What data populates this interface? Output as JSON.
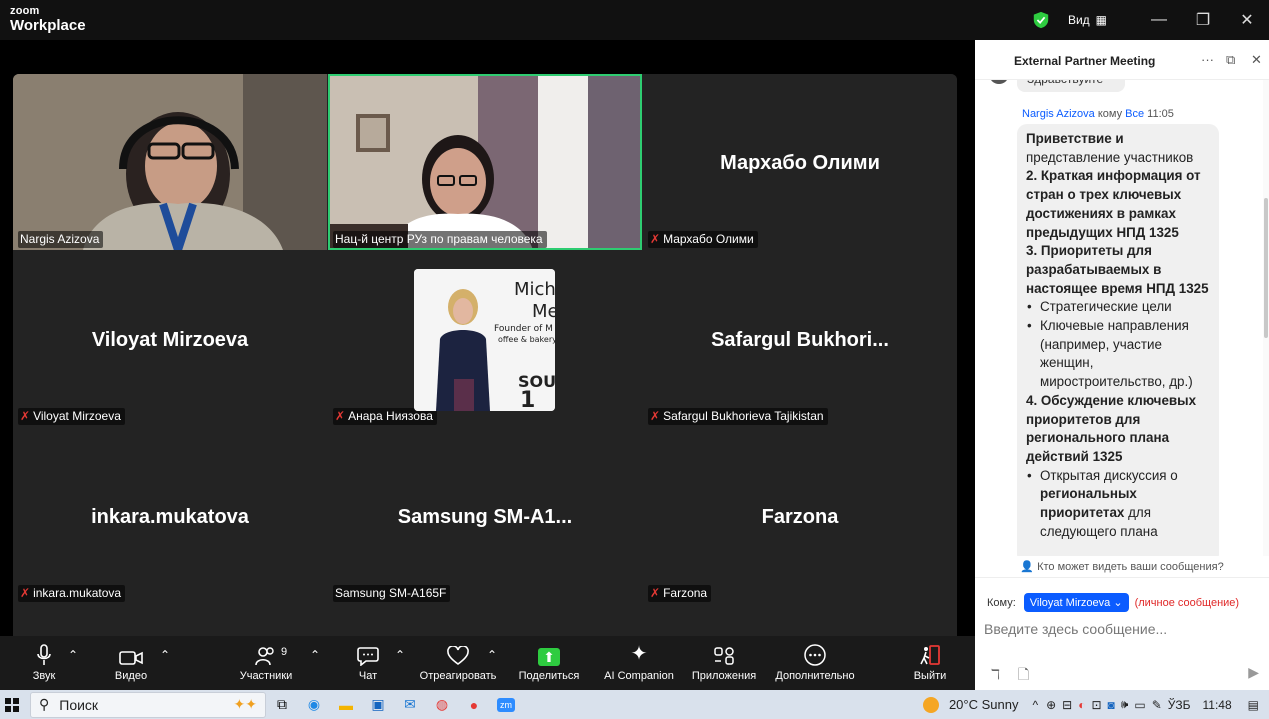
{
  "titlebar": {
    "brand_small": "zoom",
    "brand_large": "Workplace",
    "view_label": "Вид",
    "view_icon": "grid-icon",
    "security_color": "#2ecc40"
  },
  "gallery": {
    "tiles": [
      {
        "big_name": "",
        "label": "Nargis Azizova",
        "muted": false,
        "video": true
      },
      {
        "big_name": "",
        "label": "Нац-й центр РУз по правам человека",
        "muted": false,
        "video": true,
        "active_speaker": true
      },
      {
        "big_name": "Мархабо Олими",
        "label": "Мархабо Олими",
        "muted": true
      },
      {
        "big_name": "Viloyat Mirzoeva",
        "label": "Viloyat Mirzoeva",
        "muted": true
      },
      {
        "big_name": "",
        "label": "Анара Ниязова",
        "muted": true,
        "photo": true
      },
      {
        "big_name": "Safargul  Bukhori...",
        "label": "Safargul Bukhorieva Tajikistan",
        "muted": true
      },
      {
        "big_name": "inkara.mukatova",
        "label": "inkara.mukatova",
        "muted": true
      },
      {
        "big_name": "Samsung  SM-A1...",
        "label": "Samsung SM-A165F",
        "muted": false
      },
      {
        "big_name": "Farzona",
        "label": "Farzona",
        "muted": true
      }
    ],
    "photo_text": [
      "Mich",
      "Me",
      "Founder of M",
      "offee & bakery",
      "SOU",
      "1"
    ]
  },
  "controls": {
    "audio": "Звук",
    "video": "Видео",
    "participants": "Участники",
    "participants_count": "9",
    "chat": "Чат",
    "react": "Отреагировать",
    "share": "Поделиться",
    "ai": "AI Companion",
    "apps": "Приложения",
    "more": "Дополнительно",
    "leave": "Выйти"
  },
  "chat": {
    "title": "External Partner Meeting",
    "prev_message": "Здравствуйте",
    "sender": "Nargis Azizova",
    "to_word": "кому",
    "to_target": "Все",
    "time": "11:05",
    "message": {
      "l1": "Приветствие и",
      "l2": "представление участников",
      "h2": "2. Краткая информация от стран о трех ключевых достижениях в рамках предыдущих НПД 1325",
      "h3": "3. Приоритеты для разрабатываемых в настоящее время НПД 1325",
      "b1": "Стратегические цели",
      "b2": "Ключевые направления (например, участие женщин, миростроительство, др.)",
      "h4": "4. Обсуждение ключевых приоритетов для регионального плана действий 1325",
      "b3_pre": "Открытая дискуссия о",
      "b3_bold": "региональных приоритетах",
      "b3_post": "для следующего плана"
    },
    "who_can_see": "Кто может видеть ваши сообщения?",
    "to_label": "Кому:",
    "recipient": "Viloyat Mirzoeva",
    "private_label": "(личное сообщение)",
    "input_placeholder": "Введите здесь сообщение..."
  },
  "taskbar": {
    "search": "Поиск",
    "weather": "20°C  Sunny",
    "lang": "ЎЗБ",
    "clock": "11:48"
  }
}
